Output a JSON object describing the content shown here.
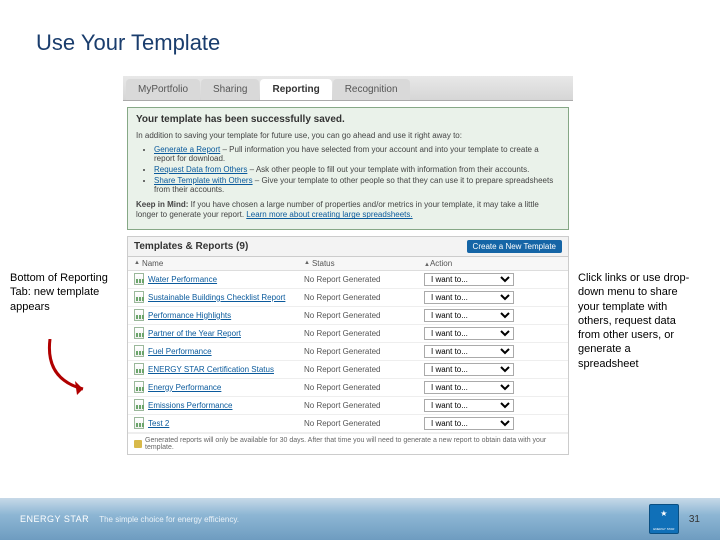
{
  "slide_title": "Use Your Template",
  "tabs": [
    "MyPortfolio",
    "Sharing",
    "Reporting",
    "Recognition"
  ],
  "active_tab_index": 2,
  "success": {
    "title": "Your template has been successfully saved.",
    "intro": "In addition to saving your template for future use, you can go ahead and use it right away to:",
    "items": [
      {
        "link": "Generate a Report",
        "rest": " – Pull information you have selected from your account and into your template to create a report for download."
      },
      {
        "link": "Request Data from Others",
        "rest": " – Ask other people to fill out your template with information from their accounts."
      },
      {
        "link": "Share Template with Others",
        "rest": " – Give your template to other people so that they can use it to prepare spreadsheets from their accounts."
      }
    ],
    "keep_bold": "Keep in Mind:",
    "keep_text": " If you have chosen a large number of properties and/or metrics in your template, it may take a little longer to generate your report. ",
    "keep_link": "Learn more about creating large spreadsheets."
  },
  "templates": {
    "heading": "Templates & Reports (9)",
    "new_btn": "Create a New Template",
    "cols": {
      "name": "Name",
      "status": "Status",
      "action": "Action"
    },
    "rows": [
      {
        "name": "Water Performance",
        "status": "No Report Generated",
        "action": "I want to..."
      },
      {
        "name": "Sustainable Buildings Checklist Report",
        "status": "No Report Generated",
        "action": "I want to..."
      },
      {
        "name": "Performance Highlights",
        "status": "No Report Generated",
        "action": "I want to..."
      },
      {
        "name": "Partner of the Year Report",
        "status": "No Report Generated",
        "action": "I want to..."
      },
      {
        "name": "Fuel Performance",
        "status": "No Report Generated",
        "action": "I want to..."
      },
      {
        "name": "ENERGY STAR Certification Status",
        "status": "No Report Generated",
        "action": "I want to..."
      },
      {
        "name": "Energy Performance",
        "status": "No Report Generated",
        "action": "I want to..."
      },
      {
        "name": "Emissions Performance",
        "status": "No Report Generated",
        "action": "I want to..."
      },
      {
        "name": "Test 2",
        "status": "No Report Generated",
        "action": "I want to..."
      }
    ],
    "note": "Generated reports will only be available for 30 days. After that time you will need to generate a new report to obtain data with your template."
  },
  "left_note": "Bottom of Reporting Tab: new template appears",
  "right_note": "Click links or use drop-down menu to share your template with others, request data from other users, or generate a spreadsheet",
  "footer": {
    "brand": "ENERGY STAR",
    "tag": "The simple choice for energy efficiency.",
    "page": "31"
  }
}
